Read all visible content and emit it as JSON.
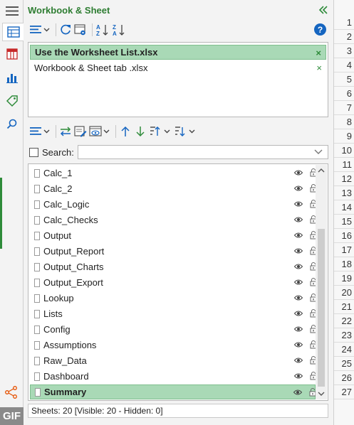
{
  "header": {
    "title": "Workbook & Sheet"
  },
  "toolbar1": {
    "icons": [
      "list-options-icon",
      "refresh-icon",
      "settings-icon",
      "sort-asc-icon",
      "sort-desc-icon"
    ],
    "help_label": "?"
  },
  "rail": {
    "icons": [
      "workbook-sheet-icon",
      "columns-icon",
      "chart-icon",
      "tag-icon",
      "search-icon",
      "share-icon"
    ]
  },
  "workbooks": [
    {
      "name": "Use the Worksheet List.xlsx",
      "selected": true,
      "close": "×"
    },
    {
      "name": "Workbook & Sheet tab .xlsx",
      "selected": false,
      "close": "×"
    }
  ],
  "toolbar2": {
    "icons": [
      "list-options-icon",
      "swap-icon",
      "edit-icon",
      "view-icon",
      "move-up-icon",
      "move-down-icon",
      "sort-up-icon",
      "sort-down-icon"
    ]
  },
  "search": {
    "label": "Search:",
    "value": "",
    "placeholder": ""
  },
  "sheets": [
    {
      "name": "Calc_1",
      "selected": false
    },
    {
      "name": "Calc_2",
      "selected": false
    },
    {
      "name": "Calc_Logic",
      "selected": false
    },
    {
      "name": "Calc_Checks",
      "selected": false
    },
    {
      "name": "Output",
      "selected": false
    },
    {
      "name": "Output_Report",
      "selected": false
    },
    {
      "name": "Output_Charts",
      "selected": false
    },
    {
      "name": "Output_Export",
      "selected": false
    },
    {
      "name": "Lookup",
      "selected": false
    },
    {
      "name": "Lists",
      "selected": false
    },
    {
      "name": "Config",
      "selected": false
    },
    {
      "name": "Assumptions",
      "selected": false
    },
    {
      "name": "Raw_Data",
      "selected": false
    },
    {
      "name": "Dashboard",
      "selected": false
    },
    {
      "name": "Summary",
      "selected": true
    }
  ],
  "status": {
    "text": "Sheets: 20  [Visible: 20 - Hidden: 0]"
  },
  "row_numbers": [
    "1",
    "2",
    "3",
    "4",
    "5",
    "6",
    "7",
    "8",
    "9",
    "10",
    "11",
    "12",
    "13",
    "14",
    "15",
    "16",
    "17",
    "18",
    "19",
    "20",
    "21",
    "22",
    "23",
    "24",
    "25",
    "26",
    "27"
  ],
  "badge": {
    "text": "GIF"
  },
  "colors": {
    "accent": "#2e8b3a",
    "selected_row": "#a9d9b6",
    "title": "#2e7d32",
    "help": "#1565c0"
  }
}
